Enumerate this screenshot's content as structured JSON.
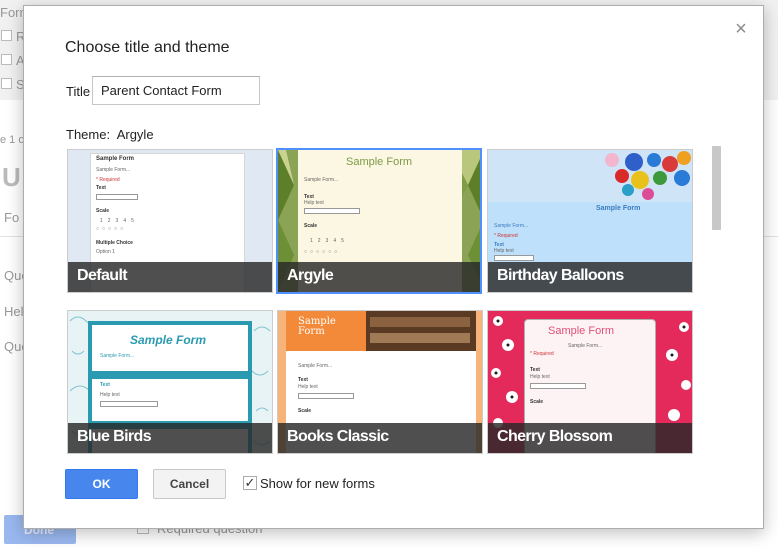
{
  "background": {
    "texts": [
      "Form",
      "R",
      "A",
      "S",
      "e 1 o",
      "U",
      "Fo",
      "Que",
      "Hel",
      "Que"
    ],
    "required_label": "Required question",
    "done_label": "Done"
  },
  "dialog": {
    "heading": "Choose title and theme",
    "close_glyph": "×",
    "title_label": "Title",
    "title_value": "Parent Contact Form",
    "theme_prefix": "Theme:",
    "theme_value": "Argyle",
    "themes": [
      {
        "name": "Default",
        "selected": false
      },
      {
        "name": "Argyle",
        "selected": true
      },
      {
        "name": "Birthday Balloons",
        "selected": false
      },
      {
        "name": "Blue Birds",
        "selected": false
      },
      {
        "name": "Books Classic",
        "selected": false
      },
      {
        "name": "Cherry Blossom",
        "selected": false
      }
    ],
    "preview_text": {
      "sample_form": "Sample Form",
      "sample_form_sub": "Sample Form...",
      "text": "Text",
      "help": "Help text",
      "scale": "Scale",
      "required": "* Required",
      "multiple_choice": "Multiple Choice",
      "option": "Option 1"
    },
    "ok_label": "OK",
    "cancel_label": "Cancel",
    "checkbox_glyph": "✓",
    "show_label": "Show for new forms",
    "accent_color": "#4d90fe"
  }
}
